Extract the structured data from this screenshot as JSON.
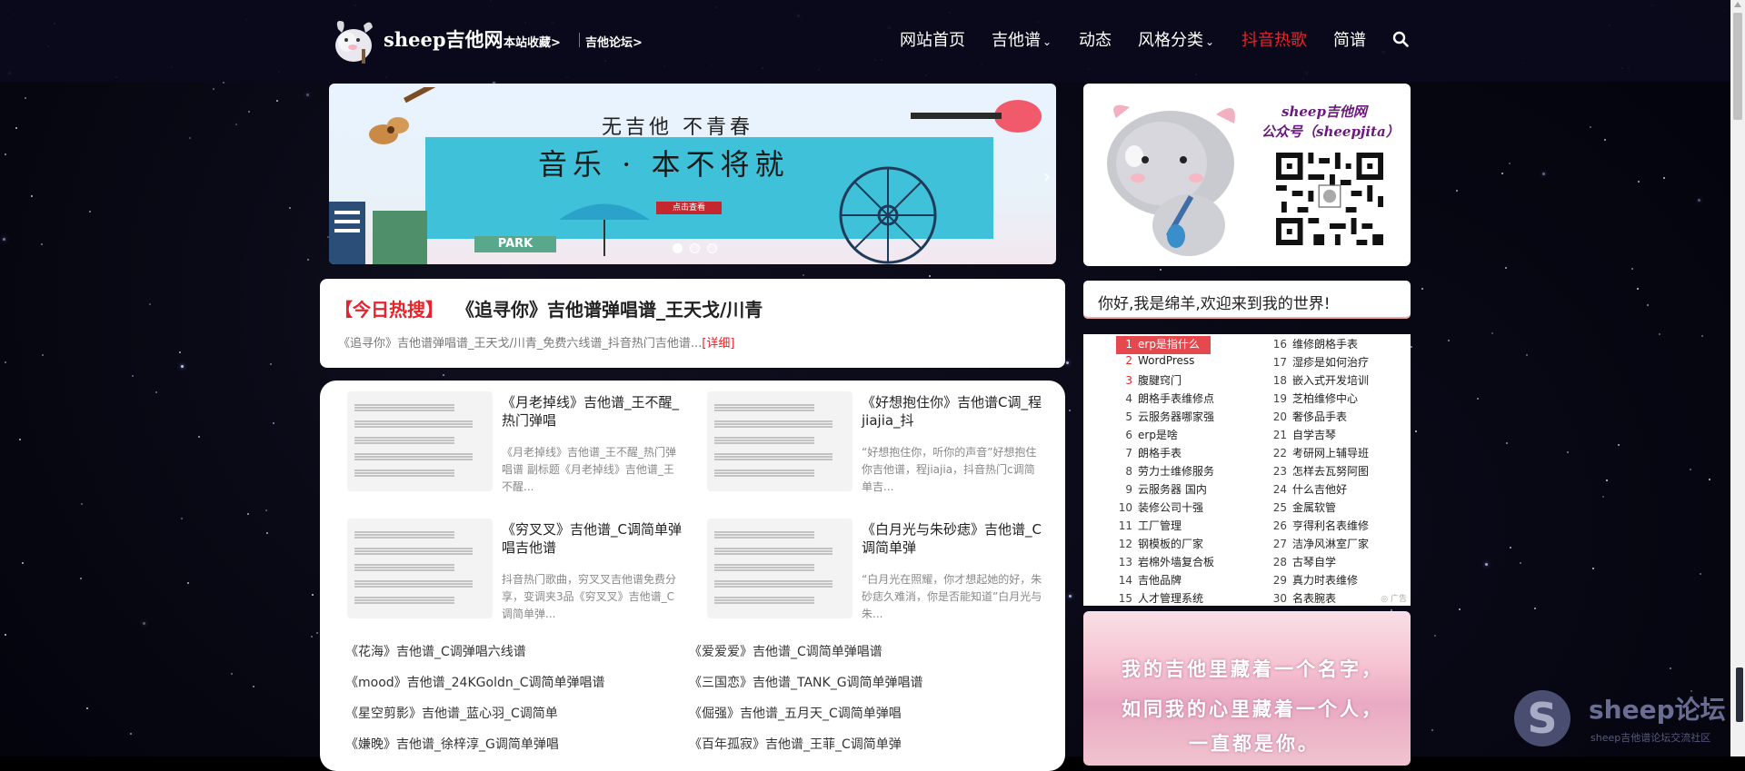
{
  "site": {
    "logo_text": "sheep吉他网",
    "link_favorite": "本站收藏>",
    "link_forum": "吉他论坛>"
  },
  "nav": [
    {
      "label": "网站首页",
      "dropdown": false
    },
    {
      "label": "吉他谱",
      "dropdown": true
    },
    {
      "label": "动态",
      "dropdown": false
    },
    {
      "label": "风格分类",
      "dropdown": true
    },
    {
      "label": "抖音热歌",
      "dropdown": false,
      "color": "#e5242b"
    },
    {
      "label": "简谱",
      "dropdown": false
    }
  ],
  "banner": {
    "slogan": "无吉他 不青春",
    "headline": "音乐 · 本不将就",
    "sign_small": "PARK",
    "button": "点击查看"
  },
  "qr": {
    "line1": "sheep吉他网",
    "line2": "公众号（sheepjita）"
  },
  "hot": {
    "tag": "【今日热搜】",
    "title": "《追寻你》吉他谱弹唱谱_王天戈/川青",
    "desc": "《追寻你》吉他谱弹唱谱_王天戈/川青_免费六线谱_抖音热门吉他谱...",
    "more": "[详细]"
  },
  "welcome": "你好,我是绵羊,欢迎来到我的世界!",
  "ranking_left": [
    {
      "n": "1",
      "t": "erp是指什么"
    },
    {
      "n": "2",
      "t": "WordPress"
    },
    {
      "n": "3",
      "t": "腹腱窍门"
    },
    {
      "n": "4",
      "t": "朗格手表维修点"
    },
    {
      "n": "5",
      "t": "云服务器哪家强"
    },
    {
      "n": "6",
      "t": "erp是啥"
    },
    {
      "n": "7",
      "t": "朗格手表"
    },
    {
      "n": "8",
      "t": "劳力士维修服务"
    },
    {
      "n": "9",
      "t": "云服务器 国内"
    },
    {
      "n": "10",
      "t": "装修公司十强"
    },
    {
      "n": "11",
      "t": "工厂管理"
    },
    {
      "n": "12",
      "t": "钢模板的厂家"
    },
    {
      "n": "13",
      "t": "岩棉外墙复合板"
    },
    {
      "n": "14",
      "t": "吉他品牌"
    },
    {
      "n": "15",
      "t": "人才管理系统"
    }
  ],
  "ranking_right": [
    {
      "n": "16",
      "t": "维修朗格手表"
    },
    {
      "n": "17",
      "t": "湿疹是如何治疗"
    },
    {
      "n": "18",
      "t": "嵌入式开发培训"
    },
    {
      "n": "19",
      "t": "芝柏维修中心"
    },
    {
      "n": "20",
      "t": "奢侈品手表"
    },
    {
      "n": "21",
      "t": "自学吉琴"
    },
    {
      "n": "22",
      "t": "考研网上辅导班"
    },
    {
      "n": "23",
      "t": "怎样去瓦努阿图"
    },
    {
      "n": "24",
      "t": "什么吉他好"
    },
    {
      "n": "25",
      "t": "金属软管"
    },
    {
      "n": "26",
      "t": "亨得利名表维修"
    },
    {
      "n": "27",
      "t": "洁净风淋室厂家"
    },
    {
      "n": "28",
      "t": "古琴自学"
    },
    {
      "n": "29",
      "t": "真力时表维修"
    },
    {
      "n": "30",
      "t": "名表腕表"
    }
  ],
  "ranking_foot": "◎ 广告",
  "posts": [
    {
      "title": "《月老掉线》吉他谱_王不醒_热门弹唱",
      "excerpt": "《月老掉线》吉他谱_王不醒_热门弹唱谱 副标题《月老掉线》吉他谱_王不醒..."
    },
    {
      "title": "《好想抱住你》吉他谱C调_程jiajia_抖",
      "excerpt": "“好想抱住你，听你的声音”好想抱住你吉他谱，程jiajia，抖音热门c调简单吉..."
    },
    {
      "title": "《穷叉叉》吉他谱_C调简单弹唱吉他谱",
      "excerpt": "抖音热门歌曲，穷叉叉吉他谱免费分享，变调夹3品《穷叉叉》吉他谱_C调简单弹..."
    },
    {
      "title": "《白月光与朱砂痣》吉他谱_C调简单弹",
      "excerpt": "“白月光在照耀，你才想起她的好，朱砂痣久难消，你是否能知道”白月光与朱..."
    }
  ],
  "links": [
    "《花海》吉他谱_C调弹唱六线谱",
    "《爱爱爱》吉他谱_C调简单弹唱谱",
    "《mood》吉他谱_24KGoldn_C调简单弹唱谱",
    "《三国恋》吉他谱_TANK_G调简单弹唱谱",
    "《星空剪影》吉他谱_蓝心羽_C调简单",
    "《倔强》吉他谱_五月天_C调简单弹唱",
    "《嫌晚》吉他谱_徐梓淳_G调简单弹唱",
    "《百年孤寂》吉他谱_王菲_C调简单弹"
  ],
  "lyric": [
    "我的吉他里藏着一个名字，",
    "如同我的心里藏着一个人，",
    "一直都是你。"
  ],
  "watermark": {
    "title": "sheep论坛",
    "sub": "sheep吉他谱论坛交流社区"
  },
  "colors": {
    "accent_red": "#e5242b",
    "header_bg": "#0a0a1c"
  }
}
